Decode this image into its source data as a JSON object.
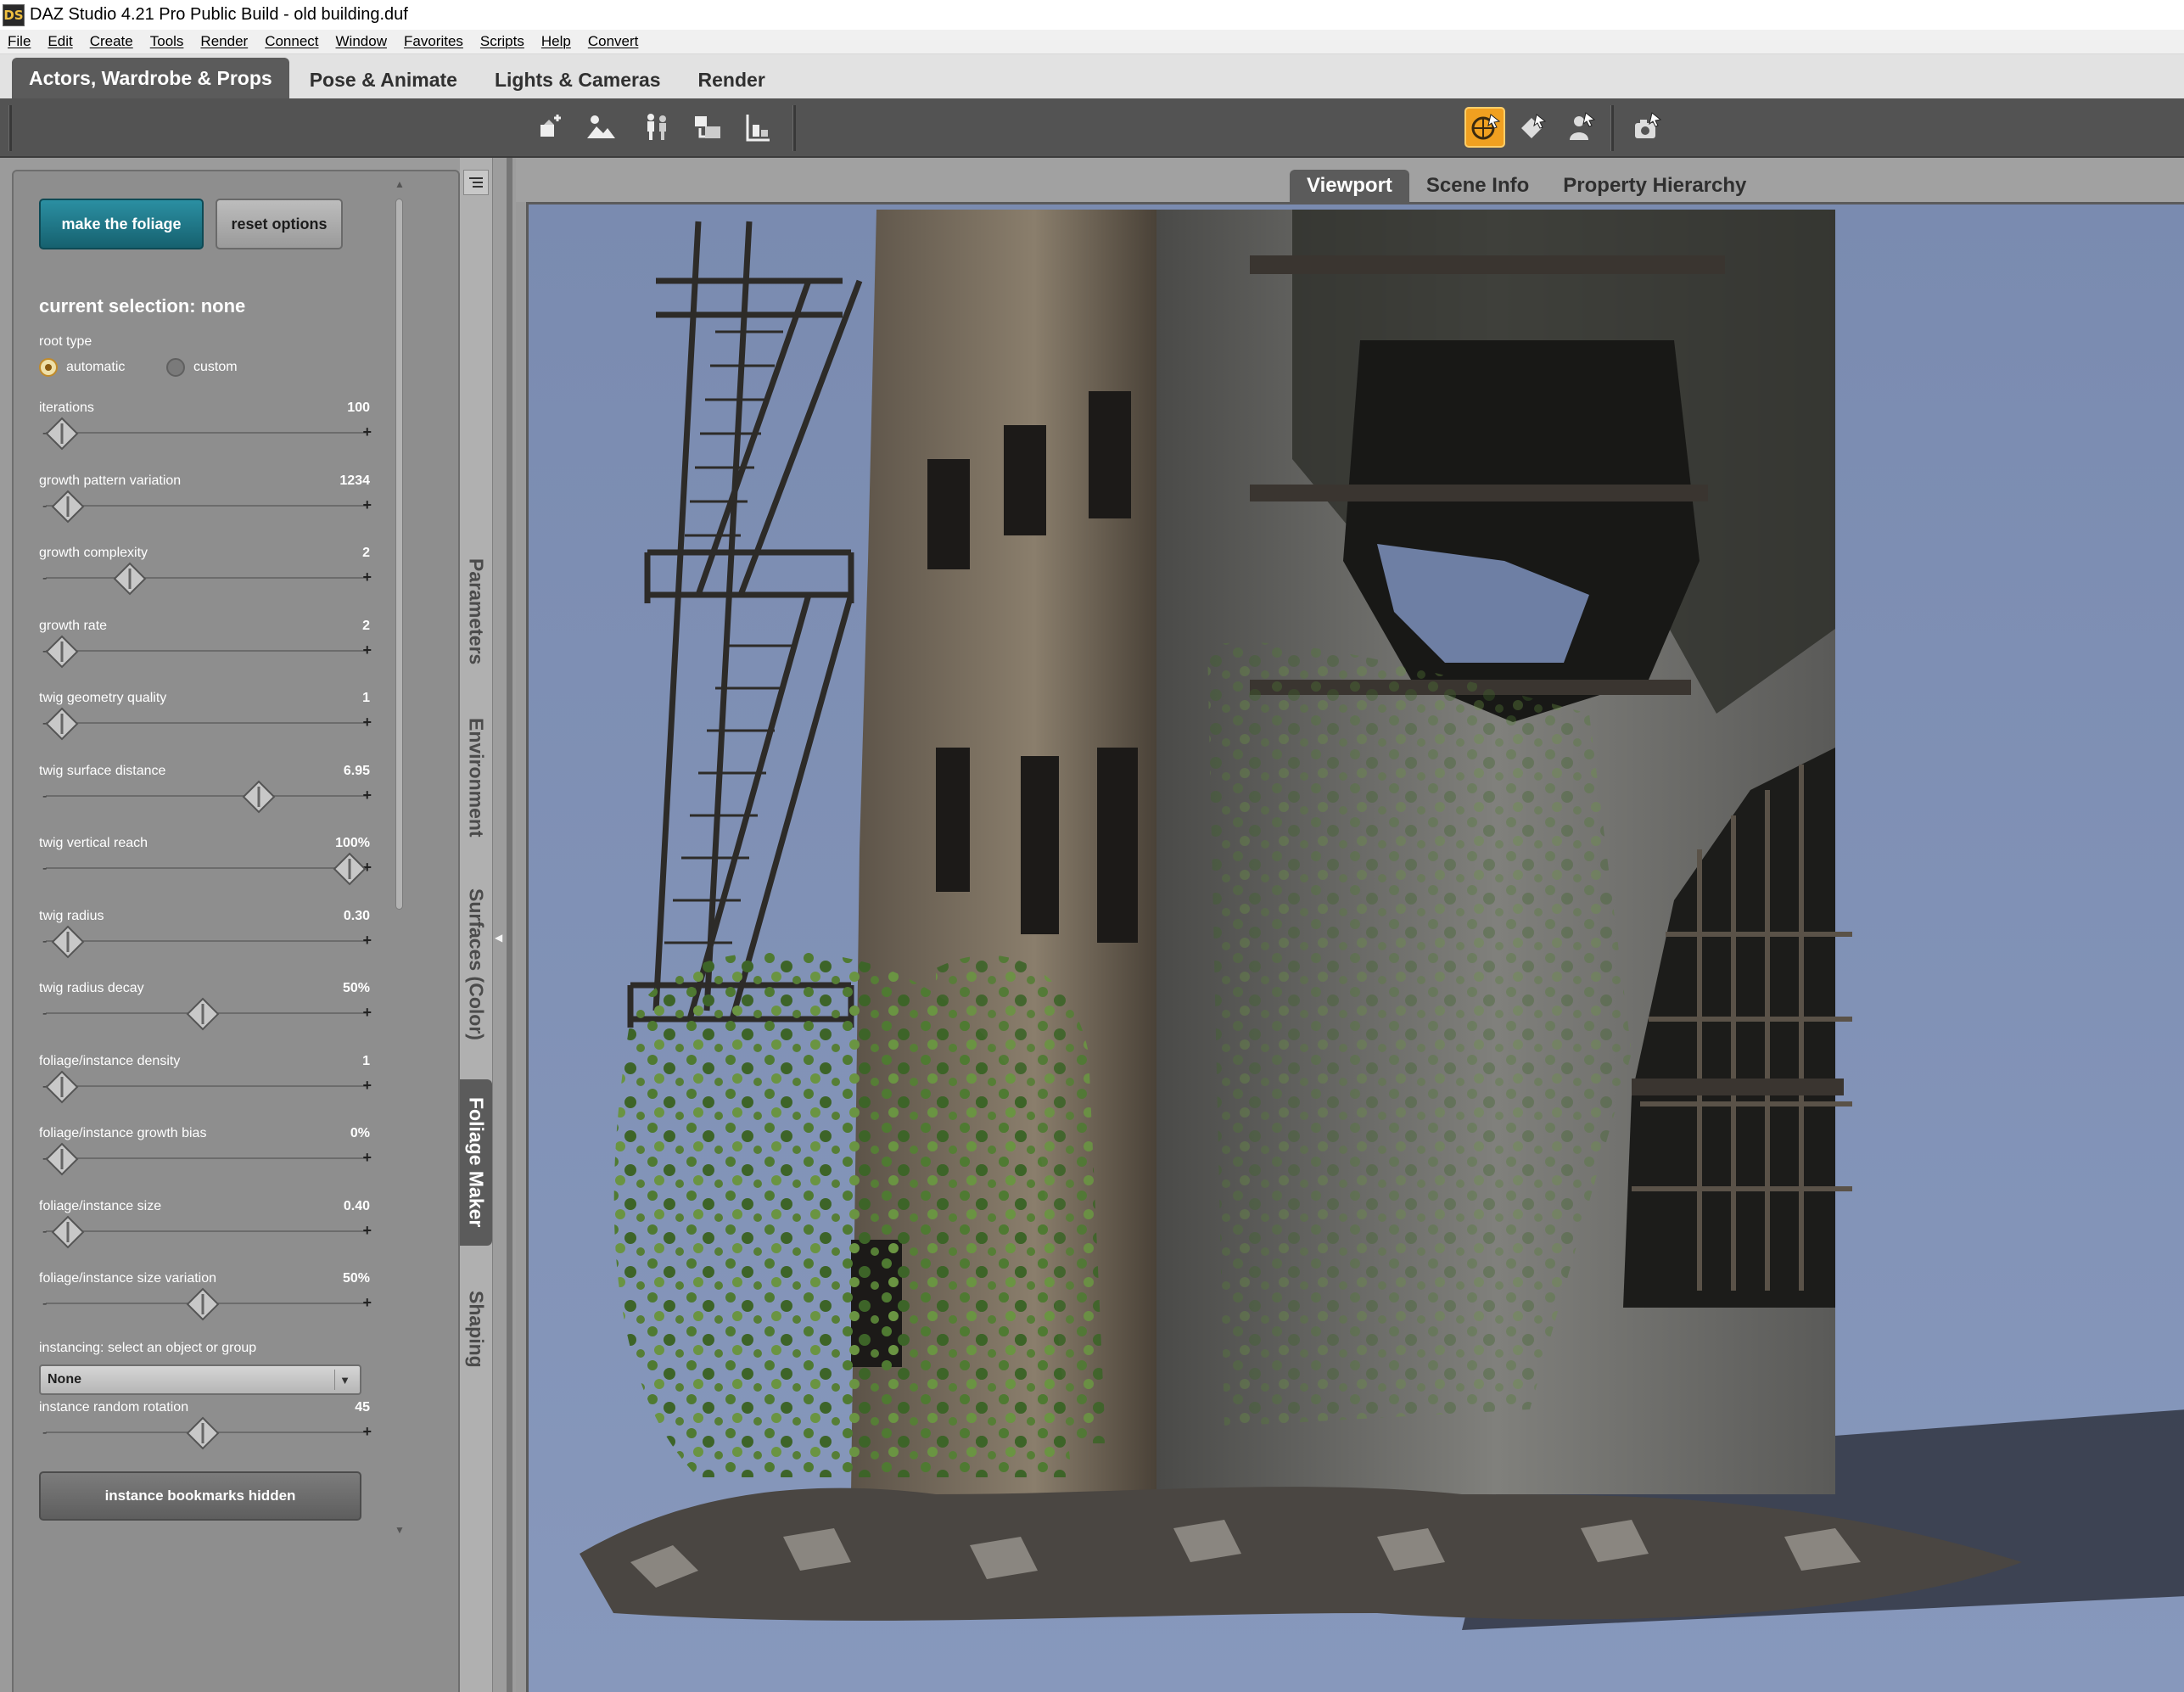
{
  "window": {
    "app_icon": "DS",
    "title": "DAZ Studio 4.21 Pro Public Build - old building.duf"
  },
  "menu": [
    "File",
    "Edit",
    "Create",
    "Tools",
    "Render",
    "Connect",
    "Window",
    "Favorites",
    "Scripts",
    "Help",
    "Convert"
  ],
  "rooms": [
    "Actors, Wardrobe & Props",
    "Pose & Animate",
    "Lights & Cameras",
    "Render"
  ],
  "toolbar": {
    "tools": [
      "place-prop-icon",
      "environment-icon",
      "figure-pose-icon",
      "scene-import-icon",
      "align-icon"
    ],
    "view_tools": [
      "universal-tool-icon",
      "node-selection-icon",
      "figure-tool-icon",
      "camera-icon"
    ],
    "active_color": "#f0a020"
  },
  "panel": {
    "make_button": "make the foliage",
    "reset_button": "reset options",
    "selection": "current selection: none",
    "root_type_label": "root type",
    "root_options": [
      "automatic",
      "custom"
    ],
    "root_selected": "automatic",
    "params": [
      {
        "label": "iterations",
        "value": "100",
        "position": 0.02
      },
      {
        "label": "growth pattern variation",
        "value": "1234",
        "position": 0.04
      },
      {
        "label": "growth complexity",
        "value": "2",
        "position": 0.25
      },
      {
        "label": "growth rate",
        "value": "2",
        "position": 0.02
      },
      {
        "label": "twig geometry quality",
        "value": "1",
        "position": 0.02
      },
      {
        "label": "twig surface distance",
        "value": "6.95",
        "position": 0.69
      },
      {
        "label": "twig vertical reach",
        "value": "100%",
        "position": 1.0
      },
      {
        "label": "twig radius",
        "value": "0.30",
        "position": 0.04
      },
      {
        "label": "twig radius decay",
        "value": "50%",
        "position": 0.5
      },
      {
        "label": "foliage/instance density",
        "value": "1",
        "position": 0.02
      },
      {
        "label": "foliage/instance growth bias",
        "value": "0%",
        "position": 0.02
      },
      {
        "label": "foliage/instance size",
        "value": "0.40",
        "position": 0.04
      },
      {
        "label": "foliage/instance size variation",
        "value": "50%",
        "position": 0.5
      }
    ],
    "instancing_label": "instancing: select an object or group",
    "instancing_value": "None",
    "rotation": {
      "label": "instance random rotation",
      "value": "45",
      "position": 0.5
    },
    "bookmarks_button": "instance bookmarks hidden",
    "accent_color": "#1e7c8c"
  },
  "side_tabs": [
    "Parameters",
    "Environment",
    "Surfaces (Color)",
    "Foliage Maker",
    "Shaping"
  ],
  "side_tab_active": "Foliage Maker",
  "viewport_tabs": [
    "Viewport",
    "Scene Info",
    "Property Hierarchy"
  ],
  "viewport_tab_active": "Viewport",
  "viewport": {
    "background": "#7e8fb3",
    "content": "render-scene"
  }
}
